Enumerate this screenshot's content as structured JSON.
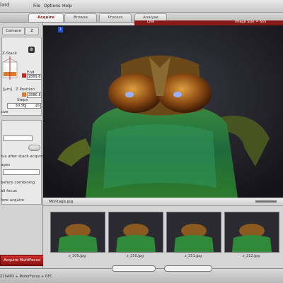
{
  "window": {
    "title": "lard"
  },
  "menu": [
    "File",
    "Options",
    "Help"
  ],
  "tabs": [
    {
      "label": "Acquire",
      "active": true
    },
    {
      "label": "Browse",
      "active": false
    },
    {
      "label": "Process",
      "active": false
    },
    {
      "label": "Analyse",
      "active": false
    }
  ],
  "viewer": {
    "live_label": "Live",
    "image_size_label": "Image Size = 655",
    "channel_badge": "1"
  },
  "left_panel": {
    "subtabs": [
      "Camera",
      "Z"
    ],
    "z_stack_label": "Z-Stack",
    "end_label": "End",
    "end_value": "2889.6",
    "units_label": "[µm]",
    "z_position_label": "Z Position",
    "z_position_value": "2886.8",
    "steps_label": "Steps",
    "steps_value": "30.56",
    "steps_count": "16",
    "size_label": "size",
    "after_stack_label": "tus after stack acquire",
    "stages_label": "ages",
    "combining_label": "before combining",
    "all_focus_label": "all focus",
    "before_acquire_label": "fore acquire",
    "acquire_button": "Acquire MultiFocus"
  },
  "montage": {
    "title": "Montage.jpg",
    "thumbs": [
      {
        "label": "z_209.jpg"
      },
      {
        "label": "z_210.jpg"
      },
      {
        "label": "z_211.jpg"
      },
      {
        "label": "z_212.jpg"
      }
    ]
  },
  "status": {
    "text": "Z16APO + MotorFocus + DFC"
  },
  "colors": {
    "accent_red": "#8a1a1a",
    "viewer_bg": "#1a1a1d"
  }
}
